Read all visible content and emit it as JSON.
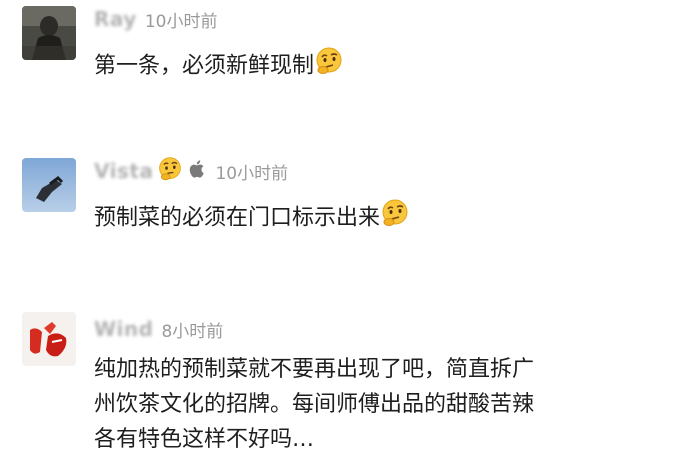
{
  "comments": [
    {
      "username": "Ray",
      "time": "10小时前",
      "text": "第一条，必须新鲜现制",
      "trailing_emoji": "thinking-face-icon"
    },
    {
      "username": "Vista",
      "time": "10小时前",
      "text": "预制菜的必须在门口标示出来",
      "name_emoji": "thinking-face-icon",
      "device_icon": "apple-icon",
      "trailing_emoji": "thinking-face-icon"
    },
    {
      "username": "Wind",
      "time": "8小时前",
      "lines": [
        "纯加热的预制菜就不要再出现了吧，简直拆广",
        "州饮茶文化的招牌。每间师傅出品的甜酸苦辣",
        "各有特色这样不好吗…"
      ]
    }
  ],
  "colors": {
    "username": "#b3b3b3",
    "timestamp": "#9a9a9a",
    "text": "#1e1e1e",
    "background": "#ffffff"
  }
}
